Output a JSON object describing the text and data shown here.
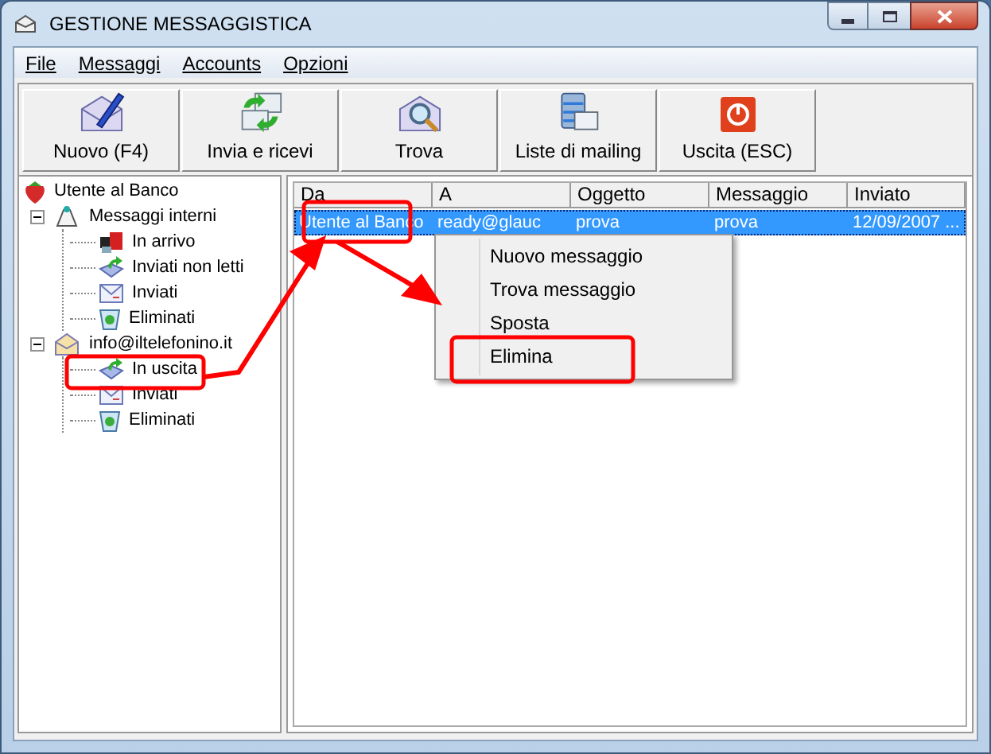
{
  "window": {
    "title": "GESTIONE MESSAGGISTICA"
  },
  "menu": [
    "File",
    "Messaggi",
    "Accounts",
    "Opzioni"
  ],
  "toolbar": [
    {
      "label": "Nuovo (F4)",
      "kind": "new"
    },
    {
      "label": "Invia e ricevi",
      "kind": "sync"
    },
    {
      "label": "Trova",
      "kind": "find"
    },
    {
      "label": "Liste di mailing",
      "kind": "lists"
    },
    {
      "label": "Uscita (ESC)",
      "kind": "exit"
    }
  ],
  "tree": {
    "label": "Utente al Banco",
    "kind": "user",
    "children": [
      {
        "label": "Messaggi interni",
        "kind": "internal",
        "expanded": true,
        "children": [
          {
            "label": "In arrivo",
            "kind": "inbox"
          },
          {
            "label": "Inviati non letti",
            "kind": "outbox"
          },
          {
            "label": "Inviati",
            "kind": "sent"
          },
          {
            "label": "Eliminati",
            "kind": "trash"
          }
        ]
      },
      {
        "label": "info@iltelefonino.it",
        "kind": "account",
        "expanded": true,
        "children": [
          {
            "label": "In uscita",
            "kind": "outbox"
          },
          {
            "label": "Inviati",
            "kind": "sent"
          },
          {
            "label": "Eliminati",
            "kind": "trash"
          }
        ]
      }
    ]
  },
  "table": {
    "columns": [
      "Da",
      "A",
      "Oggetto",
      "Messaggio",
      "Inviato"
    ],
    "rows": [
      {
        "cells": [
          "Utente al Banco",
          "ready@glauc",
          "prova",
          "prova",
          "12/09/2007 ..."
        ],
        "selected": true
      }
    ]
  },
  "context_menu": [
    "Nuovo messaggio",
    "Trova messaggio",
    "Sposta",
    "Elimina"
  ]
}
